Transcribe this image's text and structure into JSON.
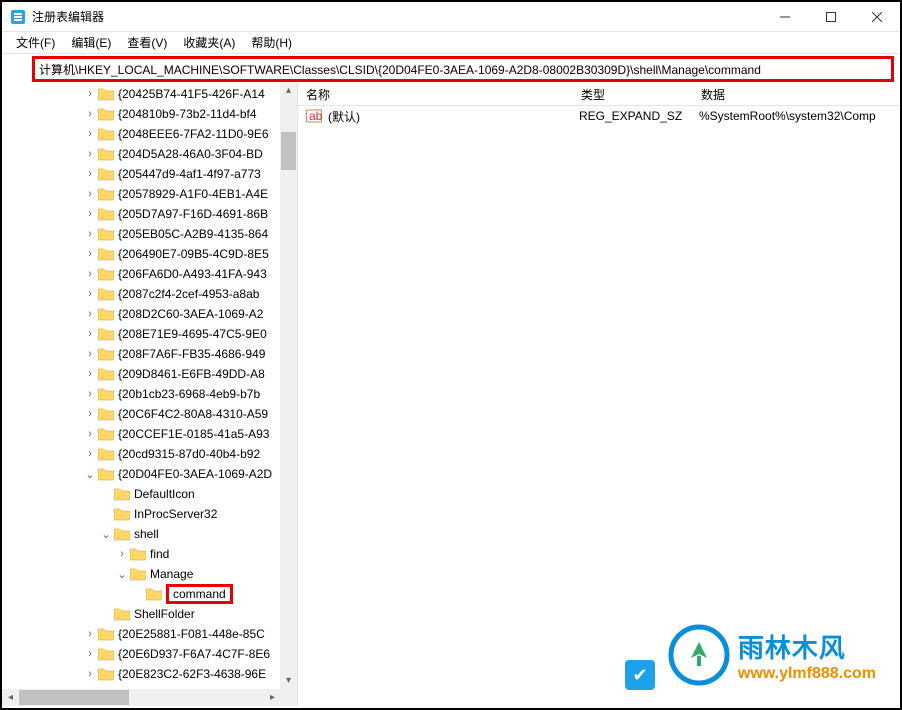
{
  "window": {
    "title": "注册表编辑器"
  },
  "menubar": {
    "file": "文件(F)",
    "edit": "编辑(E)",
    "view": "查看(V)",
    "favorites": "收藏夹(A)",
    "help": "帮助(H)"
  },
  "address": "计算机\\HKEY_LOCAL_MACHINE\\SOFTWARE\\Classes\\CLSID\\{20D04FE0-3AEA-1069-A2D8-08002B30309D}\\shell\\Manage\\command",
  "columns": {
    "name": "名称",
    "type": "类型",
    "data": "数据"
  },
  "values": [
    {
      "name": "(默认)",
      "type": "REG_EXPAND_SZ",
      "data": "%SystemRoot%\\system32\\Comp"
    }
  ],
  "tree": [
    {
      "depth": 5,
      "arrow": "collapsed",
      "label": "{20425B74-41F5-426F-A14"
    },
    {
      "depth": 5,
      "arrow": "collapsed",
      "label": "{204810b9-73b2-11d4-bf4"
    },
    {
      "depth": 5,
      "arrow": "collapsed",
      "label": "{2048EEE6-7FA2-11D0-9E6"
    },
    {
      "depth": 5,
      "arrow": "collapsed",
      "label": "{204D5A28-46A0-3F04-BD"
    },
    {
      "depth": 5,
      "arrow": "collapsed",
      "label": "{205447d9-4af1-4f97-a773"
    },
    {
      "depth": 5,
      "arrow": "collapsed",
      "label": "{20578929-A1F0-4EB1-A4E"
    },
    {
      "depth": 5,
      "arrow": "collapsed",
      "label": "{205D7A97-F16D-4691-86B"
    },
    {
      "depth": 5,
      "arrow": "collapsed",
      "label": "{205EB05C-A2B9-4135-864"
    },
    {
      "depth": 5,
      "arrow": "collapsed",
      "label": "{206490E7-09B5-4C9D-8E5"
    },
    {
      "depth": 5,
      "arrow": "collapsed",
      "label": "{206FA6D0-A493-41FA-943"
    },
    {
      "depth": 5,
      "arrow": "collapsed",
      "label": "{2087c2f4-2cef-4953-a8ab"
    },
    {
      "depth": 5,
      "arrow": "collapsed",
      "label": "{208D2C60-3AEA-1069-A2"
    },
    {
      "depth": 5,
      "arrow": "collapsed",
      "label": "{208E71E9-4695-47C5-9E0"
    },
    {
      "depth": 5,
      "arrow": "collapsed",
      "label": "{208F7A6F-FB35-4686-949"
    },
    {
      "depth": 5,
      "arrow": "collapsed",
      "label": "{209D8461-E6FB-49DD-A8"
    },
    {
      "depth": 5,
      "arrow": "collapsed",
      "label": "{20b1cb23-6968-4eb9-b7b"
    },
    {
      "depth": 5,
      "arrow": "collapsed",
      "label": "{20C6F4C2-80A8-4310-A59"
    },
    {
      "depth": 5,
      "arrow": "collapsed",
      "label": "{20CCEF1E-0185-41a5-A93"
    },
    {
      "depth": 5,
      "arrow": "collapsed",
      "label": "{20cd9315-87d0-40b4-b92"
    },
    {
      "depth": 5,
      "arrow": "expanded",
      "label": "{20D04FE0-3AEA-1069-A2D"
    },
    {
      "depth": 6,
      "arrow": "none",
      "label": "DefaultIcon"
    },
    {
      "depth": 6,
      "arrow": "none",
      "label": "InProcServer32"
    },
    {
      "depth": 6,
      "arrow": "expanded",
      "label": "shell"
    },
    {
      "depth": 7,
      "arrow": "collapsed",
      "label": "find"
    },
    {
      "depth": 7,
      "arrow": "expanded",
      "label": "Manage"
    },
    {
      "depth": 8,
      "arrow": "none",
      "label": "command",
      "selected": true
    },
    {
      "depth": 6,
      "arrow": "none",
      "label": "ShellFolder"
    },
    {
      "depth": 5,
      "arrow": "collapsed",
      "label": "{20E25881-F081-448e-85C"
    },
    {
      "depth": 5,
      "arrow": "collapsed",
      "label": "{20E6D937-F6A7-4C7F-8E6"
    },
    {
      "depth": 5,
      "arrow": "collapsed",
      "label": "{20E823C2-62F3-4638-96E"
    }
  ],
  "watermark": {
    "name": "雨林木风",
    "url": "www.ylmf888.com"
  }
}
